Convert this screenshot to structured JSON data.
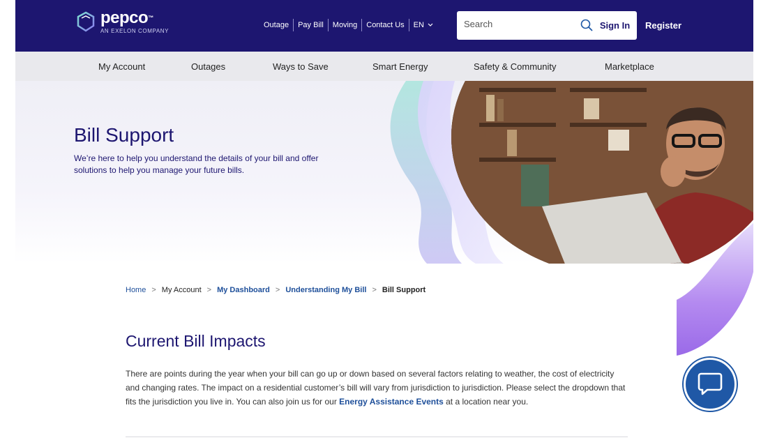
{
  "header": {
    "logo": {
      "name": "pepco",
      "trademark": "™",
      "tagline": "AN EXELON COMPANY"
    },
    "utility_links": [
      "Outage",
      "Pay Bill",
      "Moving",
      "Contact Us"
    ],
    "language": "EN",
    "search": {
      "placeholder": "Search"
    },
    "sign_in": "Sign In",
    "register": "Register"
  },
  "nav": {
    "items": [
      "My Account",
      "Outages",
      "Ways to Save",
      "Smart Energy",
      "Safety & Community",
      "Marketplace"
    ]
  },
  "hero": {
    "title": "Bill Support",
    "subtitle": "We’re here to help you understand the details of your bill and offer solutions to help you manage your future bills."
  },
  "breadcrumb": [
    {
      "label": "Home",
      "link": true
    },
    {
      "label": "My Account",
      "link": false
    },
    {
      "label": "My Dashboard",
      "link": true
    },
    {
      "label": "Understanding My Bill",
      "link": true
    },
    {
      "label": "Bill Support",
      "link": false,
      "current": true
    }
  ],
  "main": {
    "section_title": "Current Bill Impacts",
    "body_before_link": "There are points during the year when your bill can go up or down based on several factors relating to weather, the cost of electricity and changing rates. The impact on a residential customer’s bill will vary from jurisdiction to jurisdiction. Please select the dropdown that fits the jurisdiction you live in. You can also join us for our ",
    "body_link": "Energy Assistance Events",
    "body_after_link": " at a location near you."
  },
  "icons": {
    "search": "search-icon",
    "chevron": "chevron-down-icon",
    "chat": "chat-icon"
  },
  "colors": {
    "brand_navy": "#1d1670",
    "link_blue": "#1e4f9a",
    "nav_bg": "#e9e9ed",
    "chat_blue": "#1f58a6"
  }
}
